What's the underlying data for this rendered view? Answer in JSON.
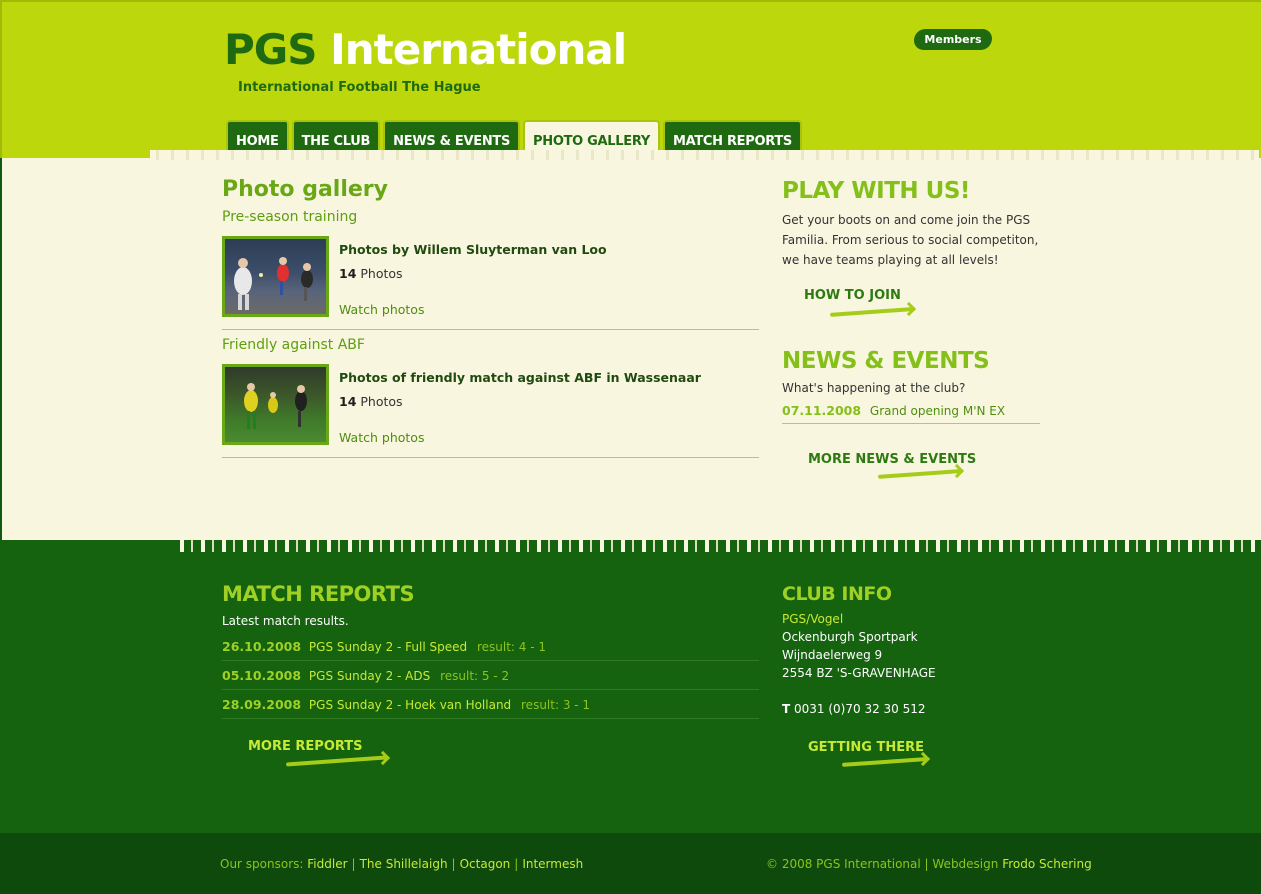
{
  "header": {
    "logo_pgs": "PGS",
    "logo_intl": "International",
    "tagline": "International Football The Hague",
    "members": "Members"
  },
  "nav": {
    "tabs": [
      {
        "label": "Home",
        "active": false
      },
      {
        "label": "The Club",
        "active": false
      },
      {
        "label": "News & Events",
        "active": false
      },
      {
        "label": "Photo Gallery",
        "active": true
      },
      {
        "label": "Match Reports",
        "active": false
      }
    ]
  },
  "main": {
    "title": "Photo gallery",
    "albums": [
      {
        "heading": "Pre-season training",
        "title": "Photos by Willem Sluyterman van Loo",
        "count": "14",
        "count_label": "Photos",
        "link": "Watch photos"
      },
      {
        "heading": "Friendly against ABF",
        "title": "Photos of friendly match against ABF in Wassenaar",
        "count": "14",
        "count_label": "Photos",
        "link": "Watch photos"
      }
    ]
  },
  "side": {
    "play_title": "Play with us!",
    "play_text": "Get your boots on and come join the PGS Familia. From serious to social competiton, we have teams playing at all levels!",
    "how_to_join": "How to join",
    "news_title": "News & Events",
    "news_intro": "What's happening at the club?",
    "news_items": [
      {
        "date": "07.11.2008",
        "text": "Grand opening M'N EX"
      }
    ],
    "more_news": "More news & events"
  },
  "match_reports": {
    "title": "Match reports",
    "intro": "Latest match results.",
    "rows": [
      {
        "date": "26.10.2008",
        "match": "PGS Sunday 2 - Full Speed",
        "result": "result: 4 - 1"
      },
      {
        "date": "05.10.2008",
        "match": "PGS Sunday 2 - ADS",
        "result": "result: 5 - 2"
      },
      {
        "date": "28.09.2008",
        "match": "PGS Sunday 2 - Hoek van Holland",
        "result": "result: 3 - 1"
      }
    ],
    "more": "More reports"
  },
  "club_info": {
    "title": "Club info",
    "name": "PGS/Vogel",
    "venue": "Ockenburgh Sportpark",
    "street": "Wijndaelerweg 9",
    "city": "2554 BZ 'S-GRAVENHAGE",
    "tel_prefix": "T",
    "tel": "0031 (0)70 32 30 512",
    "getting_there": "Getting there"
  },
  "footer": {
    "sponsors_label": "Our sponsors:",
    "sponsors": [
      "Fiddler",
      "The Shillelaigh",
      "Octagon",
      "Intermesh"
    ],
    "copyright": "© 2008 PGS International | Webdesign",
    "designer": "Frodo Schering"
  },
  "colors": {
    "lime": "#bcd80c",
    "dark_green": "#15620f",
    "cream": "#f8f6df",
    "accent_green": "#84bf1a"
  }
}
